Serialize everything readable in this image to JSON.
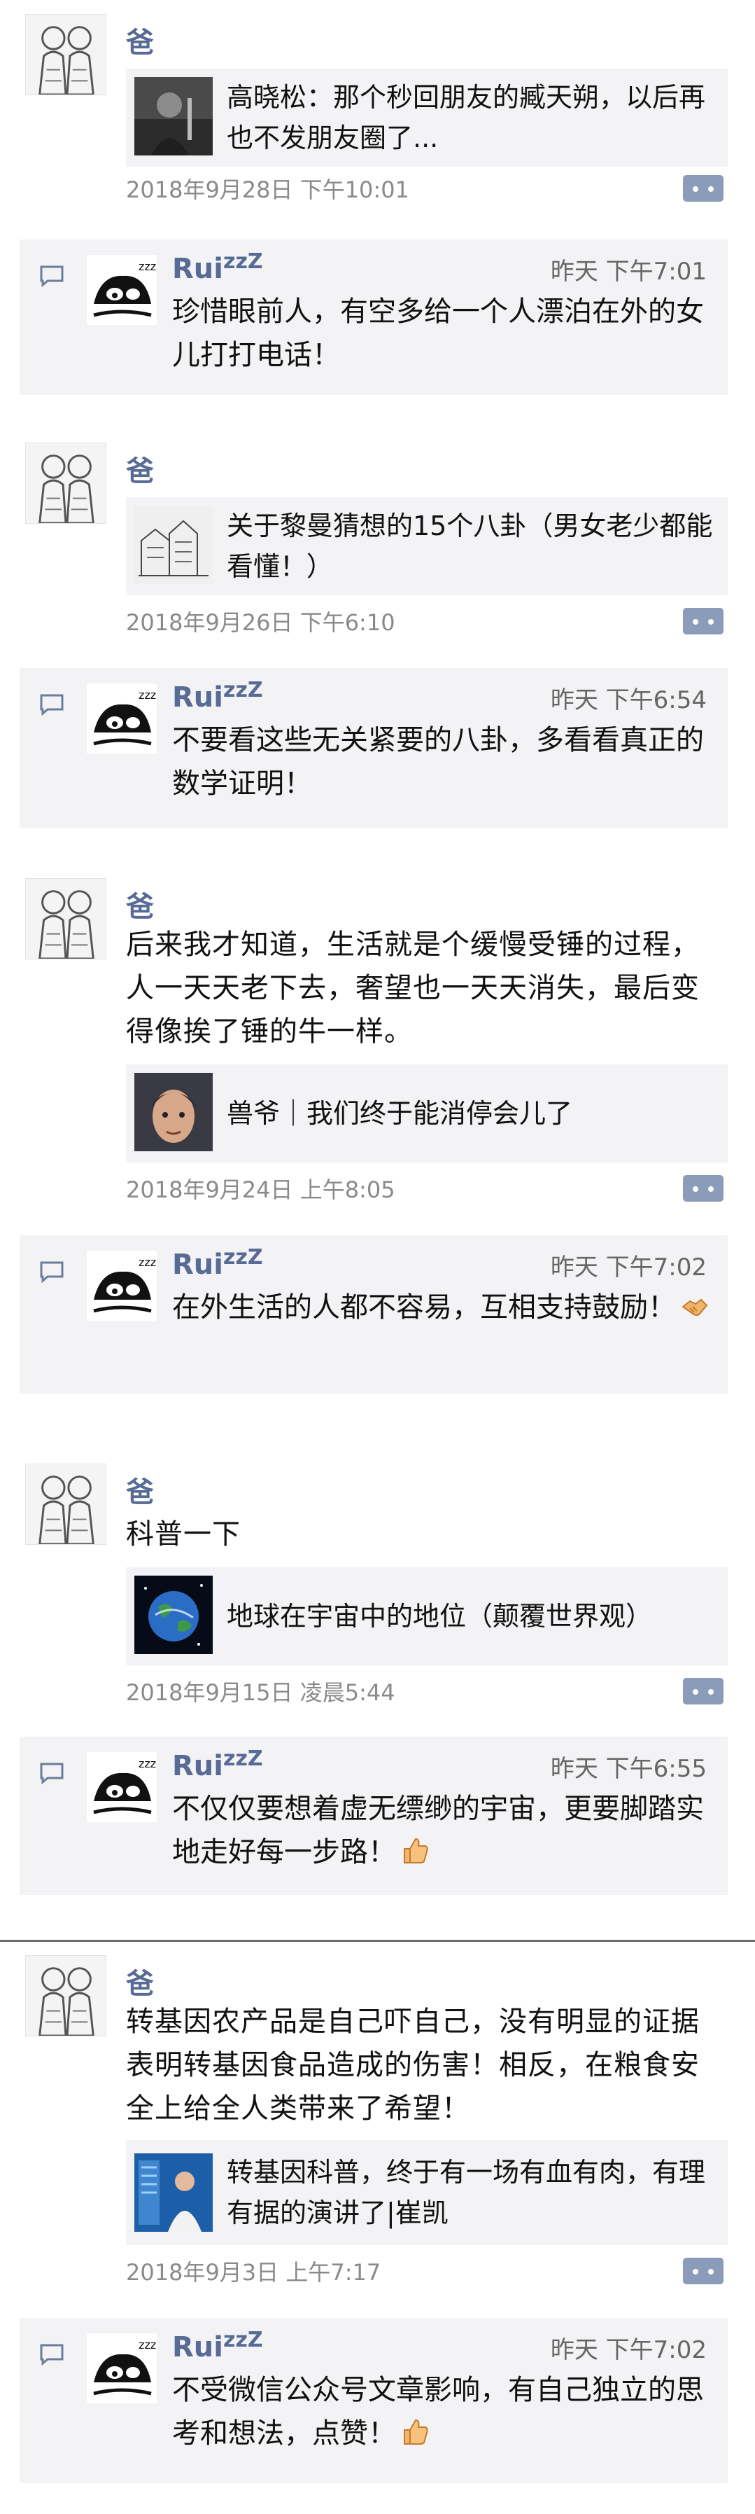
{
  "dad_name": "爸",
  "rui_name": "Rui",
  "rui_zz": "zzZ",
  "colors": {
    "name_blue": "#576b95",
    "card_bg": "#f3f3f5",
    "comment_btn": "#8a9cba"
  },
  "posts": [
    {
      "text": "",
      "link_title": "高晓松：那个秒回朋友的臧天朔，以后再也不发朋友圈了...",
      "thumb_icon": "singer-photo-icon",
      "date": "2018年9月28日 下午10:01",
      "reply": {
        "time": "昨天 下午7:01",
        "text": "珍惜眼前人，有空多给一个人漂泊在外的女儿打打电话！",
        "emoji": ""
      }
    },
    {
      "text": "",
      "link_title": "关于黎曼猜想的15个八卦（男女老少都能看懂！）",
      "thumb_icon": "building-sketch-icon",
      "date": "2018年9月26日 下午6:10",
      "reply": {
        "time": "昨天 下午6:54",
        "text": "不要看这些无关紧要的八卦，多看看真正的数学证明！",
        "emoji": ""
      }
    },
    {
      "text": "后来我才知道，生活就是个缓慢受锤的过程，人一天天老下去，奢望也一天天消失，最后变得像挨了锤的牛一样。",
      "link_title": "兽爷｜我们终于能消停会儿了",
      "thumb_icon": "face-photo-icon",
      "date": "2018年9月24日 上午8:05",
      "reply": {
        "time": "昨天 下午7:02",
        "text": "在外生活的人都不容易，互相支持鼓励！",
        "emoji": "handshake-emoji-icon"
      }
    },
    {
      "text": "科普一下",
      "link_title": "地球在宇宙中的地位（颠覆世界观）",
      "thumb_icon": "earth-icon",
      "date": "2018年9月15日 凌晨5:44",
      "reply": {
        "time": "昨天 下午6:55",
        "text": "不仅仅要想着虚无缥缈的宇宙，更要脚踏实地走好每一步路！",
        "emoji": "thumbs-up-emoji-icon"
      }
    },
    {
      "text": "转基因农产品是自己吓自己，没有明显的证据表明转基因食品造成的伤害！相反，在粮食安全上给全人类带来了希望！",
      "link_title": "转基因科普，终于有一场有血有肉，有理有据的演讲了|崔凯",
      "thumb_icon": "speaker-photo-icon",
      "date": "2018年9月3日 上午7:17",
      "reply": {
        "time": "昨天 下午7:02",
        "text": "不受微信公众号文章影响，有自己独立的思考和想法，点赞！",
        "emoji": "thumbs-up-emoji-icon"
      }
    }
  ]
}
